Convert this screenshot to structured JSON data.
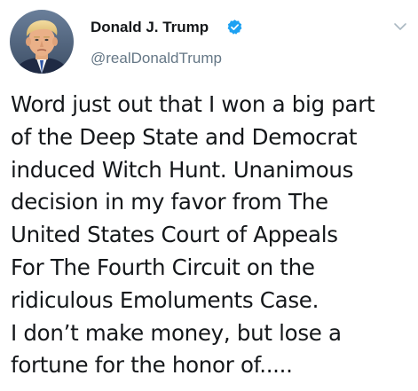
{
  "tweet": {
    "author": {
      "display_name": "Donald J. Trump",
      "handle": "@realDonaldTrump",
      "verified": true,
      "avatar_icon": "profile-photo",
      "verified_icon": "verified-badge-icon",
      "menu_icon": "chevron-down-icon"
    },
    "text_lines": [
      "Word just out that I won a big part",
      "of the Deep State and Democrat",
      "induced Witch Hunt. Unanimous",
      "decision in my favor from The",
      "United States Court of Appeals",
      "For The Fourth Circuit on the",
      "ridiculous Emoluments Case.",
      "I don’t make money, but lose a",
      "fortune for the honor of....."
    ]
  },
  "colors": {
    "text_primary": "#14171a",
    "text_secondary": "#657786",
    "verified_blue": "#1da1f2",
    "chevron": "#aab8c2",
    "background": "#ffffff"
  }
}
